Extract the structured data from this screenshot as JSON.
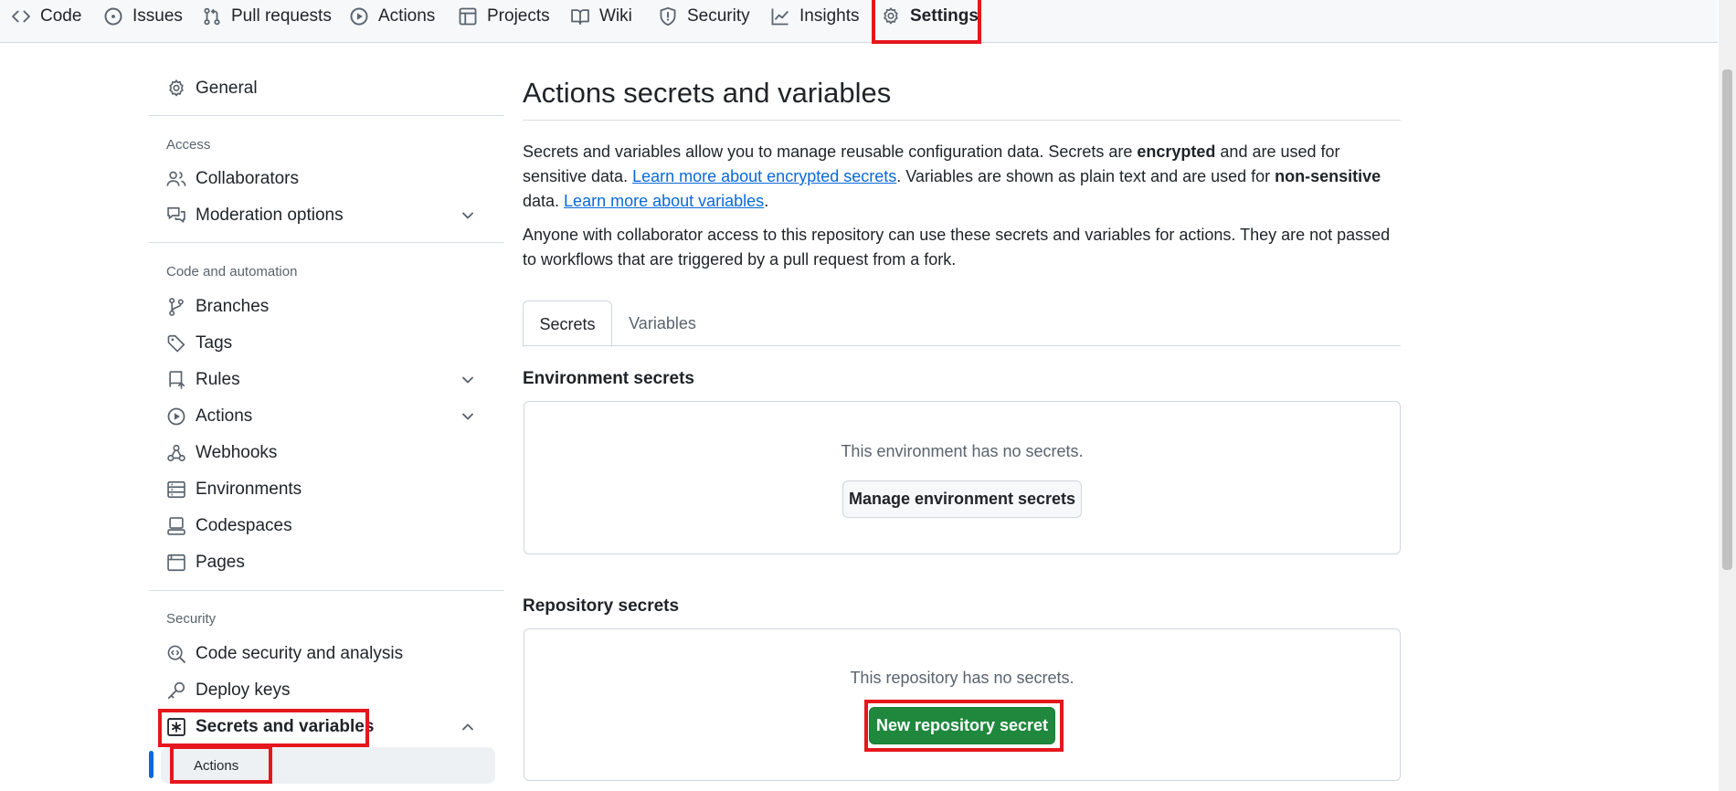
{
  "repo_nav": {
    "tabs": [
      {
        "label": "Code",
        "icon": "code-icon"
      },
      {
        "label": "Issues",
        "icon": "issue-opened-icon"
      },
      {
        "label": "Pull requests",
        "icon": "git-pull-request-icon"
      },
      {
        "label": "Actions",
        "icon": "play-icon"
      },
      {
        "label": "Projects",
        "icon": "table-icon"
      },
      {
        "label": "Wiki",
        "icon": "book-icon"
      },
      {
        "label": "Security",
        "icon": "shield-icon"
      },
      {
        "label": "Insights",
        "icon": "graph-icon"
      },
      {
        "label": "Settings",
        "icon": "gear-icon",
        "selected": true
      }
    ]
  },
  "sidebar": {
    "general": "General",
    "access_heading": "Access",
    "collaborators": "Collaborators",
    "moderation": "Moderation options",
    "code_heading": "Code and automation",
    "branches": "Branches",
    "tags": "Tags",
    "rules": "Rules",
    "actions": "Actions",
    "webhooks": "Webhooks",
    "environments": "Environments",
    "codespaces": "Codespaces",
    "pages": "Pages",
    "security_heading": "Security",
    "code_security": "Code security and analysis",
    "deploy_keys": "Deploy keys",
    "secrets_vars": "Secrets and variables",
    "secrets_sub_actions": "Actions"
  },
  "main": {
    "title": "Actions secrets and variables",
    "desc1_a": "Secrets and variables allow you to manage reusable configuration data. Secrets are ",
    "desc1_b": "encrypted",
    "desc1_c": " and are used for sensitive data. ",
    "desc1_link1": "Learn more about encrypted secrets",
    "desc1_d": ". Variables are shown as plain text and are used for ",
    "desc1_e": "non-sensitive",
    "desc1_f": " data. ",
    "desc1_link2": "Learn more about variables",
    "desc1_g": ".",
    "desc2": "Anyone with collaborator access to this repository can use these secrets and variables for actions. They are not passed to workflows that are triggered by a pull request from a fork.",
    "tabs": {
      "secrets": "Secrets",
      "variables": "Variables"
    },
    "env_heading": "Environment secrets",
    "env_empty": "This environment has no secrets.",
    "env_button": "Manage environment secrets",
    "repo_heading": "Repository secrets",
    "repo_empty": "This repository has no secrets.",
    "repo_button": "New repository secret"
  },
  "colors": {
    "highlight": "#e5171c",
    "primary_button": "#1f883d",
    "link": "#0969da"
  }
}
